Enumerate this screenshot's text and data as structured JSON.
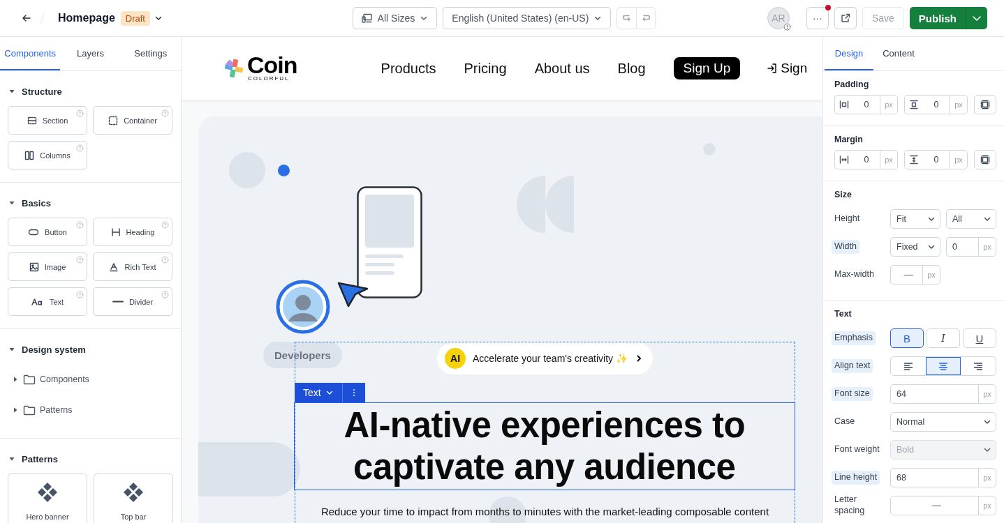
{
  "topbar": {
    "page_title": "Homepage",
    "status_badge": "Draft",
    "device_select": "All Sizes",
    "locale_select": "English (United States) (en-US)",
    "avatar_initials": "AR",
    "more_button": {
      "label": "···",
      "notification": true
    },
    "save_button": {
      "label": "Save",
      "disabled": true
    },
    "publish_button": "Publish"
  },
  "left_panel": {
    "tabs": [
      {
        "label": "Components",
        "selected": true
      },
      {
        "label": "Layers",
        "selected": false
      },
      {
        "label": "Settings",
        "selected": false
      }
    ],
    "sections": [
      {
        "title": "Structure",
        "expanded": true,
        "kind": "grid",
        "items": [
          {
            "label": "Section"
          },
          {
            "label": "Container"
          },
          {
            "label": "Columns"
          }
        ]
      },
      {
        "title": "Basics",
        "expanded": true,
        "kind": "grid",
        "items": [
          {
            "label": "Button"
          },
          {
            "label": "Heading"
          },
          {
            "label": "Image"
          },
          {
            "label": "Rich Text"
          },
          {
            "label": "Text"
          },
          {
            "label": "Divider"
          }
        ]
      },
      {
        "title": "Design system",
        "expanded": true,
        "kind": "tree",
        "items": [
          {
            "label": "Components",
            "expanded": false
          },
          {
            "label": "Patterns",
            "expanded": false
          }
        ]
      },
      {
        "title": "Patterns",
        "expanded": true,
        "kind": "cards",
        "items": [
          {
            "label": "Hero banner"
          },
          {
            "label": "Top bar"
          }
        ]
      }
    ]
  },
  "canvas": {
    "site_nav": {
      "logo": "Coin",
      "logo_tagline": "COLORFUL",
      "links": [
        "Products",
        "Pricing",
        "About us",
        "Blog"
      ],
      "signup_button": "Sign Up",
      "signin_link": "Sign"
    },
    "hero": {
      "chip": "Developers",
      "announcement": {
        "badge": "AI",
        "text": "Accelerate your team's creativity ✨"
      },
      "selection_toolbar": {
        "label": "Text"
      },
      "heading": "AI-native experiences to captivate any audience",
      "paragraph": "Reduce your time to impact from months to minutes with the market-leading composable content"
    }
  },
  "right_panel": {
    "tabs": [
      {
        "label": "Design",
        "selected": true
      },
      {
        "label": "Content",
        "selected": false
      }
    ],
    "sections": [
      {
        "title": "Padding",
        "kind": "spacing",
        "fields": [
          {
            "value": "0",
            "unit": "px"
          },
          {
            "value": "0",
            "unit": "px"
          }
        ]
      },
      {
        "title": "Margin",
        "kind": "spacing",
        "fields": [
          {
            "value": "0",
            "unit": "px"
          },
          {
            "value": "0",
            "unit": "px"
          }
        ]
      },
      {
        "title": "Size",
        "kind": "rows",
        "rows": [
          {
            "label": "Height",
            "highlighted": false,
            "kind": "pair",
            "controls": [
              {
                "kind": "select",
                "value": "Fit",
                "disabled": false
              },
              {
                "kind": "select",
                "value": "All",
                "disabled": false
              }
            ]
          },
          {
            "label": "Width",
            "highlighted": true,
            "kind": "pair",
            "controls": [
              {
                "kind": "select",
                "value": "Fixed",
                "disabled": false
              },
              {
                "kind": "number",
                "value": "0",
                "unit": "px"
              }
            ]
          },
          {
            "label": "Max-width",
            "highlighted": false,
            "kind": "pair",
            "controls": [
              {
                "kind": "number",
                "placeholder": "—",
                "unit": "px"
              }
            ]
          }
        ]
      },
      {
        "title": "Text",
        "kind": "rows",
        "rows": [
          {
            "label": "Emphasis",
            "highlighted": true,
            "kind": "single",
            "controls": [
              {
                "kind": "segmented",
                "options": [
                  {
                    "label": "B",
                    "selected": true
                  },
                  {
                    "label": "I",
                    "selected": false
                  },
                  {
                    "label": "U",
                    "selected": false
                  }
                ]
              }
            ]
          },
          {
            "label": "Align text",
            "highlighted": true,
            "kind": "single",
            "controls": [
              {
                "kind": "align",
                "options": [
                  {
                    "selected": false
                  },
                  {
                    "selected": true
                  },
                  {
                    "selected": false
                  }
                ]
              }
            ]
          },
          {
            "label": "Font size",
            "highlighted": true,
            "kind": "single",
            "controls": [
              {
                "kind": "number",
                "value": "64",
                "unit": "px"
              }
            ]
          },
          {
            "label": "Case",
            "highlighted": false,
            "kind": "single",
            "controls": [
              {
                "kind": "select",
                "value": "Normal",
                "disabled": false
              }
            ]
          },
          {
            "label": "Font weight",
            "highlighted": false,
            "kind": "single",
            "controls": [
              {
                "kind": "select",
                "value": "Bold",
                "disabled": true
              }
            ]
          },
          {
            "label": "Line height",
            "highlighted": true,
            "kind": "single",
            "controls": [
              {
                "kind": "number",
                "value": "68",
                "unit": "px"
              }
            ]
          },
          {
            "label": "Letter spacing",
            "highlighted": false,
            "kind": "single",
            "controls": [
              {
                "kind": "number",
                "placeholder": "—",
                "unit": "px"
              }
            ]
          }
        ]
      }
    ]
  }
}
